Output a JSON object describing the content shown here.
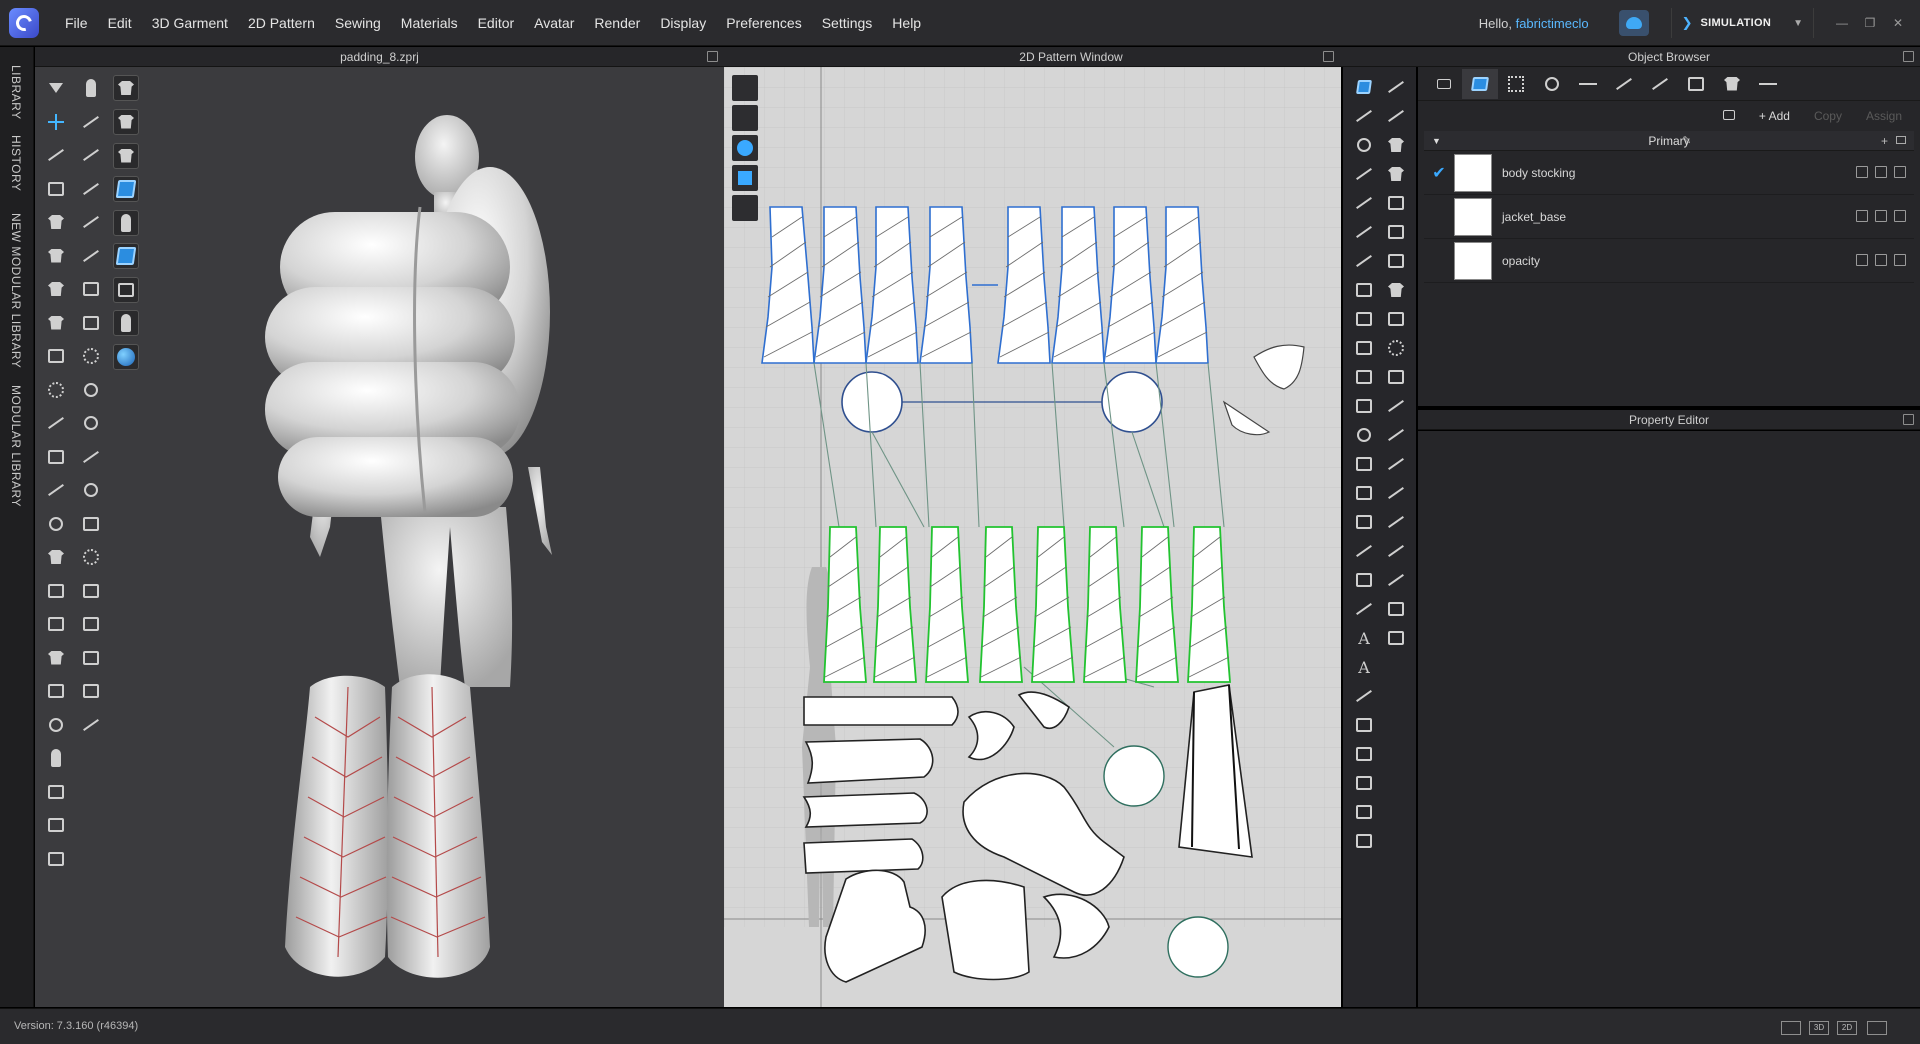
{
  "menu": {
    "items": [
      "File",
      "Edit",
      "3D Garment",
      "2D Pattern",
      "Sewing",
      "Materials",
      "Editor",
      "Avatar",
      "Render",
      "Display",
      "Preferences",
      "Settings",
      "Help"
    ],
    "greeting": "Hello,",
    "username": "fabrictimeclo",
    "mode": "SIMULATION"
  },
  "side_tabs": [
    "LIBRARY",
    "HISTORY",
    "NEW MODULAR LIBRARY",
    "MODULAR LIBRARY"
  ],
  "window3d": {
    "title": "padding_8.zprj"
  },
  "window2d": {
    "title": "2D Pattern Window"
  },
  "object_browser": {
    "title": "Object Browser",
    "add_label": "+ Add",
    "copy_label": "Copy",
    "assign_label": "Assign",
    "group": "Primary",
    "items": [
      {
        "name": "body stocking",
        "checked": true
      },
      {
        "name": "jacket_base",
        "checked": false
      },
      {
        "name": "opacity",
        "checked": false
      }
    ]
  },
  "property_editor": {
    "title": "Property Editor"
  },
  "status": {
    "version": "Version: 7.3.160 (r46394)"
  },
  "view_modes": [
    "3D",
    "2D"
  ],
  "colors": {
    "accent": "#3aa9ff",
    "selected_outline": "#2f6fd0",
    "sewing_green": "#22c330",
    "canvas": "#d6d6d6"
  },
  "icons": [
    "app-logo-icon",
    "cloud-icon",
    "check-icon",
    "eye-icon",
    "info-icon",
    "shirt-icon",
    "person-icon",
    "globe-icon"
  ]
}
